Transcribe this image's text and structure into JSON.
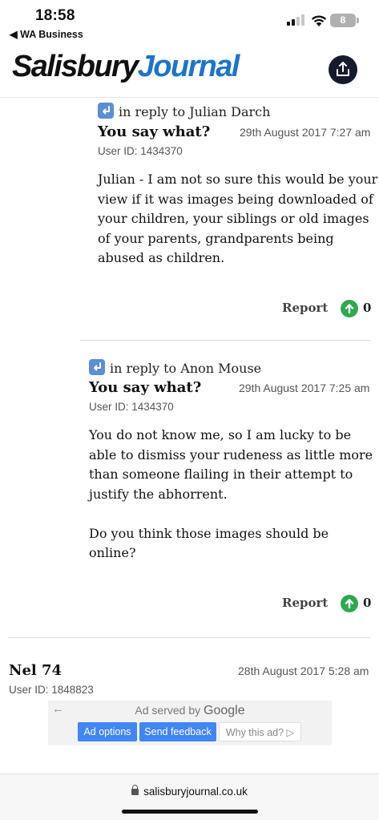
{
  "status_bar": {
    "time": "18:58",
    "back_app": "◀ WA Business",
    "battery": "8"
  },
  "header": {
    "logo_part1": "Salisbury",
    "logo_part2": "Journal",
    "brand_color": "#1d74c8",
    "share_icon": "share-upload-icon"
  },
  "comments": [
    {
      "reply_to": "in reply to Julian Darch",
      "author": "You say what?",
      "date": "29th August 2017 7:27 am",
      "user_id": "User ID: 1434370",
      "body": [
        "Julian - I am not so sure this would be your",
        "view if it was images being downloaded of",
        "your children, your siblings or old images",
        "of your parents, grandparents being",
        "abused as children."
      ],
      "report_label": "Report",
      "votes": "0"
    },
    {
      "reply_to": "in reply to Anon Mouse",
      "author": "You say what?",
      "date": "29th August 2017 7:25 am",
      "user_id": "User ID: 1434370",
      "body": [
        "You do not know me, so I am lucky to be",
        "able to dismiss your rudeness as little more",
        "than someone flailing in their attempt to",
        "justify the abhorrent.",
        "",
        "Do you think those images should be",
        "online?"
      ],
      "report_label": "Report",
      "votes": "0"
    },
    {
      "author": "Nel 74",
      "date": "28th August 2017 5:28 am",
      "user_id": "User ID: 1848823"
    }
  ],
  "ad": {
    "back_arrow": "←",
    "served_by": "Ad served by",
    "google": "Google",
    "options_label": "Ad options",
    "feedback_label": "Send feedback",
    "why_label": "Why this ad? ▷"
  },
  "browser": {
    "url": "salisburyjournal.co.uk"
  },
  "colors": {
    "vote_green": "#2fa84f",
    "reply_icon_blue": "#5b8fd6",
    "ad_blue": "#4285f4"
  }
}
